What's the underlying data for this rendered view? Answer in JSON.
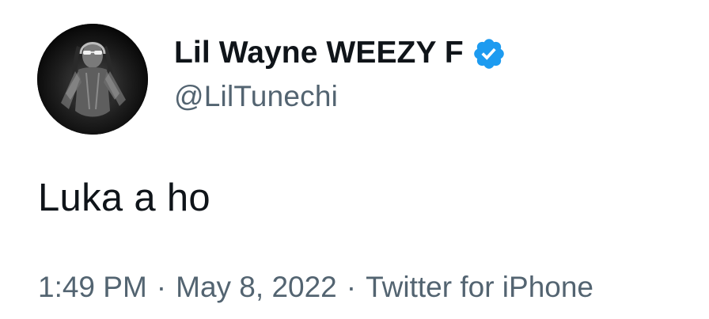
{
  "author": {
    "display_name": "Lil Wayne WEEZY F",
    "handle": "@LilTunechi",
    "verified": true,
    "avatar_icon": "profile-photo-avatar"
  },
  "tweet": {
    "text": "Luka a ho",
    "time": "1:49 PM",
    "date": "May 8, 2022",
    "source": "Twitter for iPhone",
    "separator": "·"
  },
  "colors": {
    "text_primary": "#0f1419",
    "text_secondary": "#536471",
    "verified_blue": "#1d9bf0",
    "background": "#ffffff"
  }
}
